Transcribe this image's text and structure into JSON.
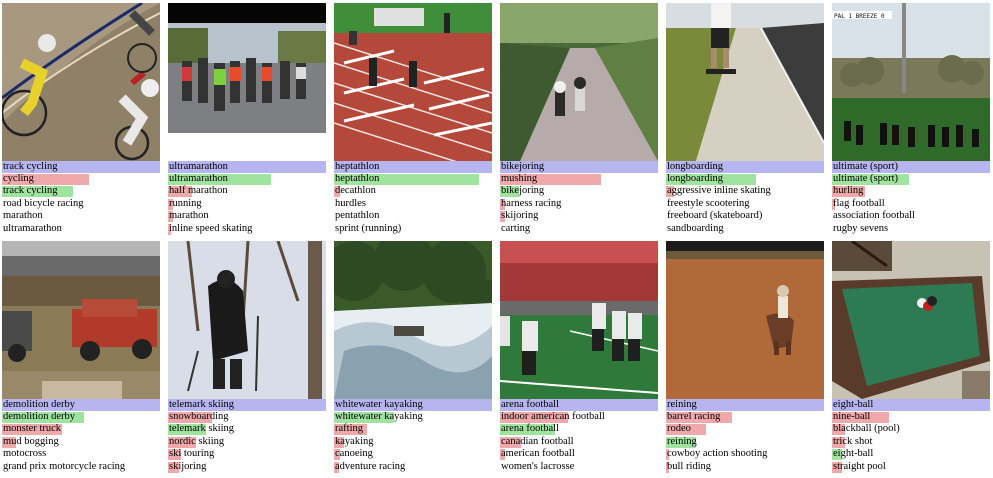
{
  "rows": [
    [
      {
        "truth": "track cycling",
        "preds": [
          {
            "label": "cycling",
            "p": 0.55,
            "correct": false
          },
          {
            "label": "track cycling",
            "p": 0.45,
            "correct": true
          },
          {
            "label": "road bicycle racing",
            "p": 0.0,
            "correct": false
          },
          {
            "label": "marathon",
            "p": 0.0,
            "correct": false
          },
          {
            "label": "ultramarathon",
            "p": 0.0,
            "correct": false
          }
        ]
      },
      {
        "truth": "ultramarathon",
        "preds": [
          {
            "label": "ultramarathon",
            "p": 0.65,
            "correct": true
          },
          {
            "label": "half marathon",
            "p": 0.15,
            "correct": false
          },
          {
            "label": "running",
            "p": 0.03,
            "correct": false
          },
          {
            "label": "marathon",
            "p": 0.03,
            "correct": false
          },
          {
            "label": "inline speed skating",
            "p": 0.02,
            "correct": false
          }
        ]
      },
      {
        "truth": "heptathlon",
        "preds": [
          {
            "label": "heptathlon",
            "p": 0.92,
            "correct": true
          },
          {
            "label": "decathlon",
            "p": 0.04,
            "correct": false
          },
          {
            "label": "hurdles",
            "p": 0.0,
            "correct": false
          },
          {
            "label": "pentathlon",
            "p": 0.0,
            "correct": false
          },
          {
            "label": "sprint (running)",
            "p": 0.0,
            "correct": false
          }
        ]
      },
      {
        "truth": "bikejoring",
        "preds": [
          {
            "label": "mushing",
            "p": 0.64,
            "correct": false
          },
          {
            "label": "bikejoring",
            "p": 0.12,
            "correct": true
          },
          {
            "label": "harness racing",
            "p": 0.03,
            "correct": false
          },
          {
            "label": "skijoring",
            "p": 0.03,
            "correct": false
          },
          {
            "label": "carting",
            "p": 0.0,
            "correct": false
          }
        ]
      },
      {
        "truth": "longboarding",
        "preds": [
          {
            "label": "longboarding",
            "p": 0.57,
            "correct": true
          },
          {
            "label": "aggressive inline skating",
            "p": 0.05,
            "correct": false
          },
          {
            "label": "freestyle scootering",
            "p": 0.0,
            "correct": false
          },
          {
            "label": "freeboard (skateboard)",
            "p": 0.0,
            "correct": false
          },
          {
            "label": "sandboarding",
            "p": 0.0,
            "correct": false
          }
        ]
      },
      {
        "truth": "ultimate (sport)",
        "preds": [
          {
            "label": "ultimate (sport)",
            "p": 0.49,
            "correct": true
          },
          {
            "label": "hurling",
            "p": 0.21,
            "correct": false
          },
          {
            "label": "flag football",
            "p": 0.02,
            "correct": false
          },
          {
            "label": "association football",
            "p": 0.0,
            "correct": false
          },
          {
            "label": "rugby sevens",
            "p": 0.0,
            "correct": false
          }
        ]
      }
    ],
    [
      {
        "truth": "demolition derby",
        "preds": [
          {
            "label": "demolition derby",
            "p": 0.52,
            "correct": true
          },
          {
            "label": "monster truck",
            "p": 0.38,
            "correct": false
          },
          {
            "label": "mud bogging",
            "p": 0.09,
            "correct": false
          },
          {
            "label": "motocross",
            "p": 0.0,
            "correct": false
          },
          {
            "label": "grand prix motorcycle racing",
            "p": 0.0,
            "correct": false
          }
        ]
      },
      {
        "truth": "telemark skiing",
        "preds": [
          {
            "label": "snowboarding",
            "p": 0.28,
            "correct": false
          },
          {
            "label": "telemark skiing",
            "p": 0.24,
            "correct": true
          },
          {
            "label": "nordic skiing",
            "p": 0.18,
            "correct": false
          },
          {
            "label": "ski touring",
            "p": 0.08,
            "correct": false
          },
          {
            "label": "skijoring",
            "p": 0.07,
            "correct": false
          }
        ]
      },
      {
        "truth": "whitewater kayaking",
        "preds": [
          {
            "label": "whitewater kayaking",
            "p": 0.38,
            "correct": true
          },
          {
            "label": "rafting",
            "p": 0.21,
            "correct": false
          },
          {
            "label": "kayaking",
            "p": 0.06,
            "correct": false
          },
          {
            "label": "canoeing",
            "p": 0.04,
            "correct": false
          },
          {
            "label": "adventure racing",
            "p": 0.03,
            "correct": false
          }
        ]
      },
      {
        "truth": "arena football",
        "preds": [
          {
            "label": "indoor american football",
            "p": 0.43,
            "correct": false
          },
          {
            "label": "arena football",
            "p": 0.35,
            "correct": true
          },
          {
            "label": "canadian football",
            "p": 0.13,
            "correct": false
          },
          {
            "label": "american football",
            "p": 0.03,
            "correct": false
          },
          {
            "label": "women's lacrosse",
            "p": 0.0,
            "correct": false
          }
        ]
      },
      {
        "truth": "reining",
        "preds": [
          {
            "label": "barrel racing",
            "p": 0.42,
            "correct": false
          },
          {
            "label": "rodeo",
            "p": 0.25,
            "correct": false
          },
          {
            "label": "reining",
            "p": 0.19,
            "correct": true
          },
          {
            "label": "cowboy action shooting",
            "p": 0.02,
            "correct": false
          },
          {
            "label": "bull riding",
            "p": 0.02,
            "correct": false
          }
        ]
      },
      {
        "truth": "eight-ball",
        "preds": [
          {
            "label": "nine-ball",
            "p": 0.36,
            "correct": false
          },
          {
            "label": "blackball (pool)",
            "p": 0.08,
            "correct": false
          },
          {
            "label": "trick shot",
            "p": 0.08,
            "correct": false
          },
          {
            "label": "eight-ball",
            "p": 0.06,
            "correct": true
          },
          {
            "label": "straight pool",
            "p": 0.06,
            "correct": false
          }
        ]
      }
    ]
  ],
  "scene_text": {
    "c0_5": "PAL 1 BREEZE 0"
  }
}
